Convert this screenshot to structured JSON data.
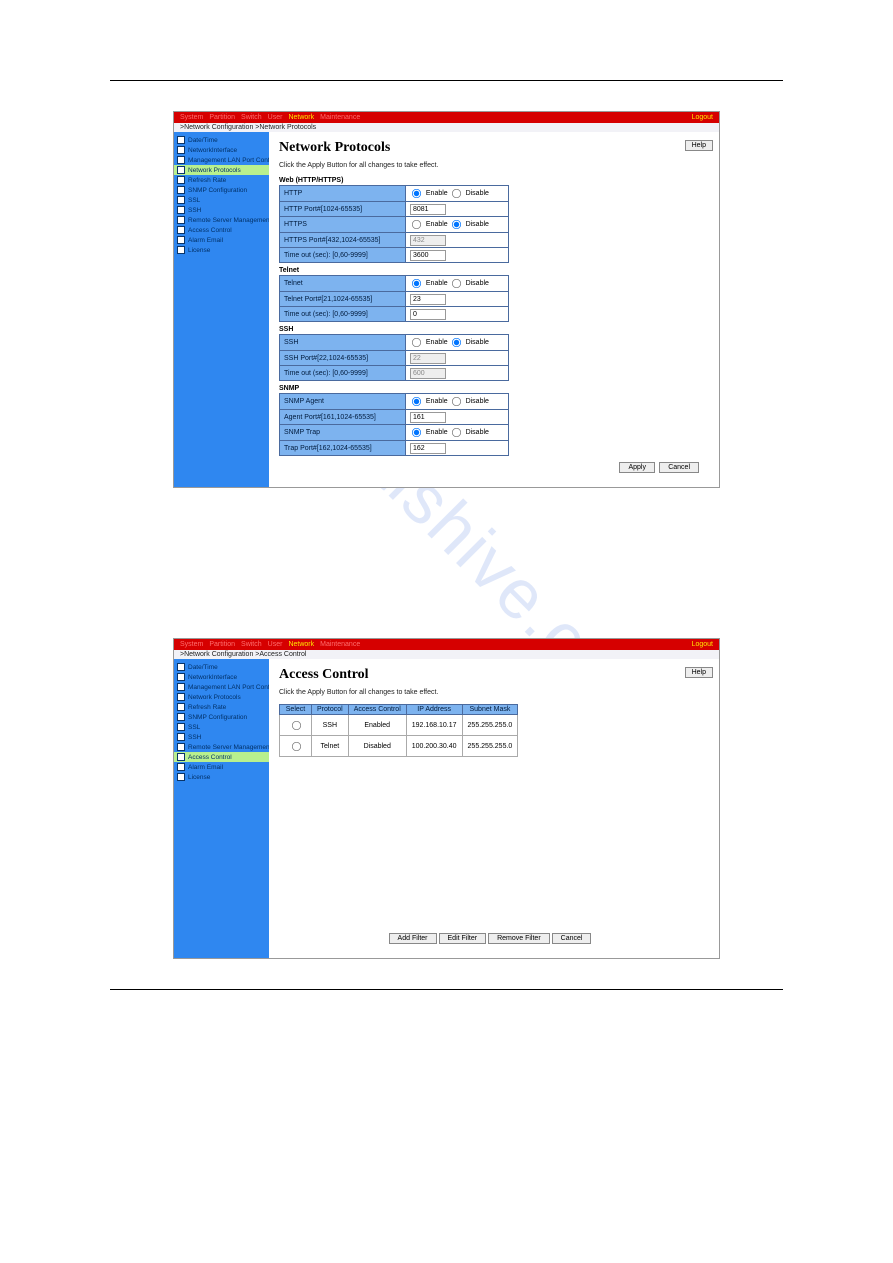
{
  "watermark": "manualshive.com",
  "topMenu": [
    "System",
    "Partition",
    "Switch",
    "User"
  ],
  "topMenuActive": "Network",
  "topMenuAfter": "Maintenance",
  "logout": "Logout",
  "helpLabel": "Help",
  "applyLabel": "Apply",
  "cancelLabel": "Cancel",
  "enableLabel": "Enable",
  "disableLabel": "Disable",
  "panel1": {
    "crumb": ">Network Configuration >Network Protocols",
    "sidebar": [
      {
        "label": "Date/Time",
        "sel": false
      },
      {
        "label": "NetworkInterface",
        "sel": false
      },
      {
        "label": "Management LAN Port Configurat",
        "sel": false
      },
      {
        "label": "Network Protocols",
        "sel": true
      },
      {
        "label": "Refresh Rate",
        "sel": false
      },
      {
        "label": "SNMP Configuration",
        "sel": false
      },
      {
        "label": "SSL",
        "sel": false
      },
      {
        "label": "SSH",
        "sel": false
      },
      {
        "label": "Remote Server Management",
        "sel": false
      },
      {
        "label": "Access Control",
        "sel": false
      },
      {
        "label": "Alarm Email",
        "sel": false
      },
      {
        "label": "License",
        "sel": false
      }
    ],
    "title": "Network Protocols",
    "hint": "Click the Apply Button for all changes to take effect.",
    "sections": [
      {
        "label": "Web (HTTP/HTTPS)",
        "rows": [
          {
            "k": "HTTP",
            "type": "radio",
            "sel": "enable"
          },
          {
            "k": "HTTP Port#[1024-65535]",
            "type": "input",
            "val": "8081"
          },
          {
            "k": "HTTPS",
            "type": "radio",
            "sel": "disable"
          },
          {
            "k": "HTTPS Port#[432,1024-65535]",
            "type": "input",
            "val": "432",
            "disabled": true
          },
          {
            "k": "Time out (sec): [0,60-9999]",
            "type": "input",
            "val": "3600"
          }
        ]
      },
      {
        "label": "Telnet",
        "rows": [
          {
            "k": "Telnet",
            "type": "radio",
            "sel": "enable"
          },
          {
            "k": "Telnet Port#[21,1024-65535]",
            "type": "input",
            "val": "23"
          },
          {
            "k": "Time out (sec): [0,60-9999]",
            "type": "input",
            "val": "0"
          }
        ]
      },
      {
        "label": "SSH",
        "rows": [
          {
            "k": "SSH",
            "type": "radio",
            "sel": "disable"
          },
          {
            "k": "SSH Port#[22,1024-65535]",
            "type": "input",
            "val": "22",
            "disabled": true
          },
          {
            "k": "Time out (sec): [0,60-9999]",
            "type": "input",
            "val": "600",
            "disabled": true
          }
        ]
      },
      {
        "label": "SNMP",
        "rows": [
          {
            "k": "SNMP Agent",
            "type": "radio",
            "sel": "enable"
          },
          {
            "k": "Agent Port#[161,1024-65535]",
            "type": "input",
            "val": "161"
          },
          {
            "k": "SNMP Trap",
            "type": "radio",
            "sel": "enable"
          },
          {
            "k": "Trap Port#[162,1024-65535]",
            "type": "input",
            "val": "162"
          }
        ]
      }
    ]
  },
  "panel2": {
    "crumb": ">Network Configuration >Access Control",
    "sidebar": [
      {
        "label": "Date/Time",
        "sel": false
      },
      {
        "label": "NetworkInterface",
        "sel": false
      },
      {
        "label": "Management LAN Port Configurat",
        "sel": false
      },
      {
        "label": "Network Protocols",
        "sel": false
      },
      {
        "label": "Refresh Rate",
        "sel": false
      },
      {
        "label": "SNMP Configuration",
        "sel": false
      },
      {
        "label": "SSL",
        "sel": false
      },
      {
        "label": "SSH",
        "sel": false
      },
      {
        "label": "Remote Server Management",
        "sel": false
      },
      {
        "label": "Access Control",
        "sel": true
      },
      {
        "label": "Alarm Email",
        "sel": false
      },
      {
        "label": "License",
        "sel": false
      }
    ],
    "title": "Access Control",
    "hint": "Click the Apply Button for all changes to take effect.",
    "headers": [
      "Select",
      "Protocol",
      "Access Control",
      "IP Address",
      "Subnet Mask"
    ],
    "rows": [
      {
        "protocol": "SSH",
        "access": "Enabled",
        "ip": "192.168.10.17",
        "mask": "255.255.255.0"
      },
      {
        "protocol": "Telnet",
        "access": "Disabled",
        "ip": "100.200.30.40",
        "mask": "255.255.255.0"
      }
    ],
    "buttons": [
      "Add Filter",
      "Edit Filter",
      "Remove Filter",
      "Cancel"
    ]
  }
}
